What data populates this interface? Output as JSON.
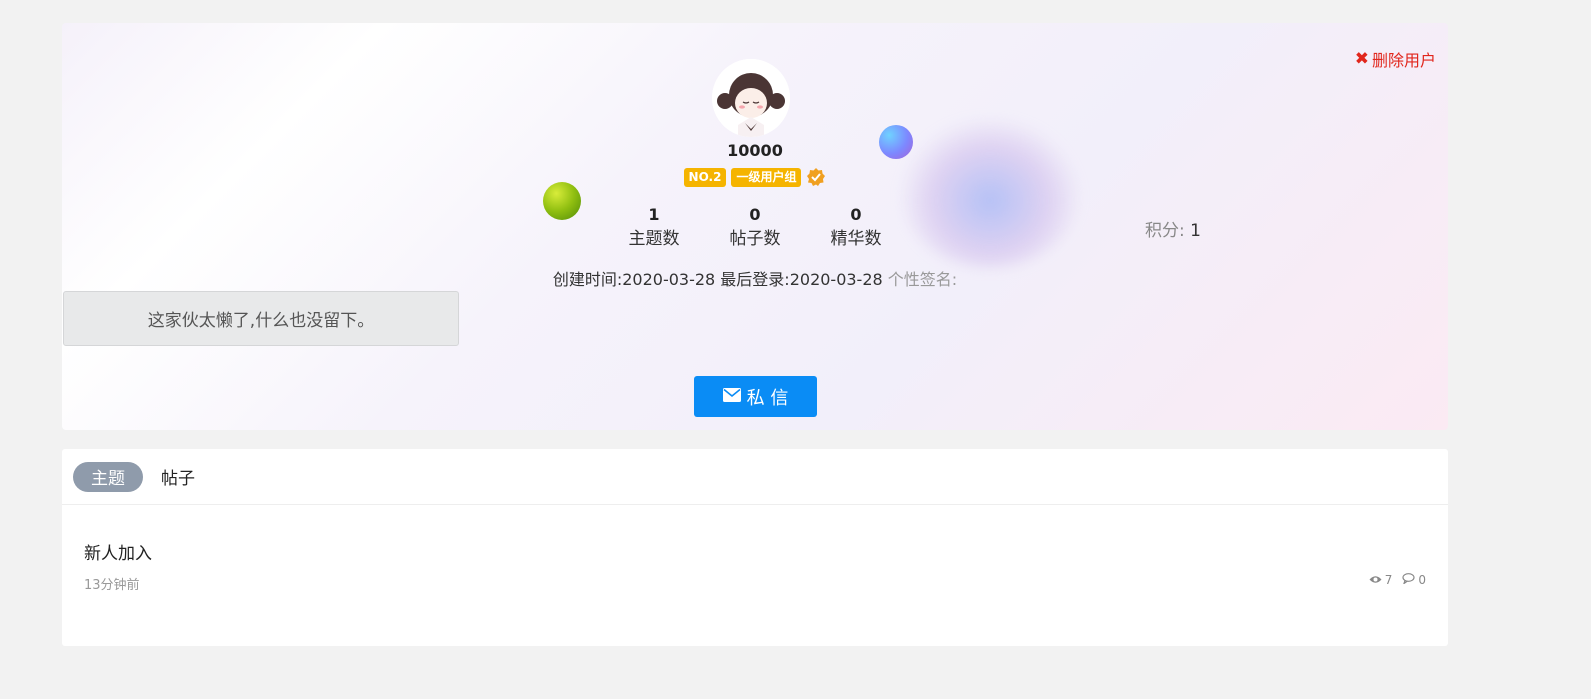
{
  "profile": {
    "delete_user_label": "删除用户",
    "username": "10000",
    "rank_badge": "NO.2",
    "group_badge": "一级用户组",
    "stats": [
      {
        "value": "1",
        "label": "主题数"
      },
      {
        "value": "0",
        "label": "帖子数"
      },
      {
        "value": "0",
        "label": "精华数"
      }
    ],
    "points_label": "积分:",
    "points_value": "1",
    "created_label": "创建时间:",
    "created_value": "2020-03-28",
    "last_login_label": "最后登录:",
    "last_login_value": "2020-03-28",
    "signature_label": "个性签名:",
    "signature_text": "这家伙太懒了,什么也没留下。",
    "pm_button_label": "私 信"
  },
  "content": {
    "tabs": [
      "主题",
      "帖子"
    ],
    "posts": [
      {
        "title": "新人加入",
        "time": "13分钟前",
        "views": "7",
        "comments": "0"
      }
    ]
  },
  "colors": {
    "accent": "#0a8cf5",
    "danger": "#e1261c",
    "badge": "#f5b400",
    "tab_active": "#8f9bab"
  }
}
